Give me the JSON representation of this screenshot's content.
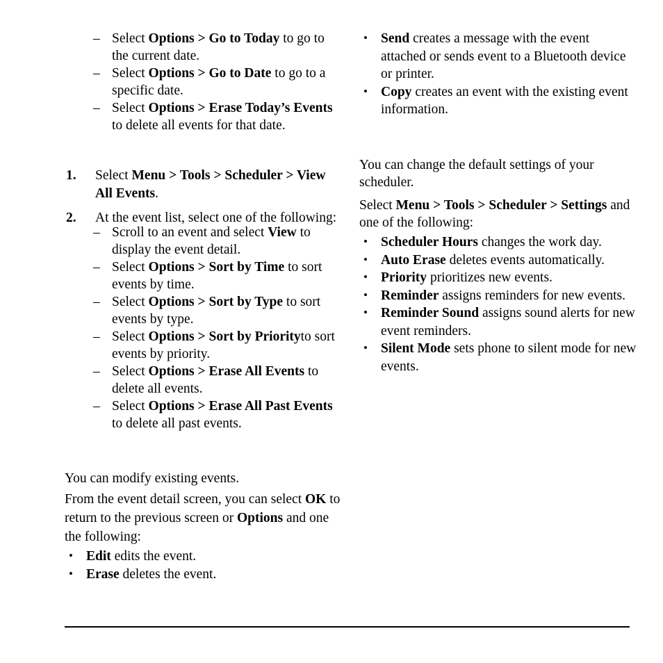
{
  "page": {
    "background": "#ffffff",
    "text_color": "#000000",
    "rule_color": "#000000"
  },
  "left_column": {
    "dash_list_top": {
      "marker": "–",
      "items": [
        {
          "pre": "Select ",
          "bold1": "Options > Go to Today",
          "post": " to go to the current date."
        },
        {
          "pre": "Select ",
          "bold1": "Options > Go to Date",
          "post": " to go to a specific date."
        },
        {
          "pre": "Select ",
          "bold1": "Options > Erase Today’s Events",
          "post": " to delete all events for that date."
        }
      ]
    },
    "numbered_list": {
      "items": [
        {
          "marker": "1.",
          "pre": "Select ",
          "bold1": "Menu > Tools  > Scheduler > View All Events",
          "post": "."
        },
        {
          "marker": "2.",
          "pre": "At the event list, select one of the following:",
          "bold1": "",
          "post": ""
        }
      ]
    },
    "dash_list_events": {
      "marker": "–",
      "items": [
        {
          "pre": "Scroll to an event and select ",
          "bold1": "View",
          "post": " to display the event detail."
        },
        {
          "pre": "Select ",
          "bold1": "Options > Sort by Time",
          "post": " to sort events by time."
        },
        {
          "pre": "Select ",
          "bold1": "Options > Sort by Type",
          "post": " to sort events by type."
        },
        {
          "pre": "Select ",
          "bold1": "Options > Sort by Priority",
          "post": "to sort events by priority."
        },
        {
          "pre": "Select ",
          "bold1": "Options > Erase All Events",
          "post": " to delete all events."
        },
        {
          "pre": "Select ",
          "bold1": "Options > Erase All Past Events",
          "post": " to delete all past events."
        }
      ]
    },
    "modify_section": {
      "intro": "You can modify existing events.",
      "body_pre": "From the event detail screen, you can select ",
      "body_bold1": "OK",
      "body_mid": " to return to the previous screen or ",
      "body_bold2": "Options",
      "body_post": " and one the following:",
      "bullets": {
        "marker": "•",
        "items": [
          {
            "bold1": "Edit",
            "post": " edits the event."
          },
          {
            "bold1": "Erase",
            "post": " deletes the event."
          }
        ]
      }
    }
  },
  "right_column": {
    "bullets_top": {
      "marker": "•",
      "items": [
        {
          "bold1": "Send",
          "post": " creates a message with the event attached or sends event to a Bluetooth device or printer."
        },
        {
          "bold1": "Copy",
          "post": " creates an event with the existing event information."
        }
      ]
    },
    "settings_section": {
      "intro": "You can change the default settings of your scheduler.",
      "select_pre": "Select ",
      "select_bold": "Menu > Tools > Scheduler > Settings",
      "select_post": " and one of the following:",
      "bullets": {
        "marker": "•",
        "items": [
          {
            "bold1": "Scheduler Hours",
            "post": " changes the work day."
          },
          {
            "bold1": "Auto Erase",
            "post": " deletes events automatically."
          },
          {
            "bold1": "Priority",
            "post": " prioritizes new events."
          },
          {
            "bold1": "Reminder",
            "post": " assigns reminders for new events."
          },
          {
            "bold1": "Reminder Sound",
            "post": " assigns sound alerts for new event reminders."
          },
          {
            "bold1": "Silent Mode",
            "post": " sets phone to silent mode for new events."
          }
        ]
      }
    }
  }
}
